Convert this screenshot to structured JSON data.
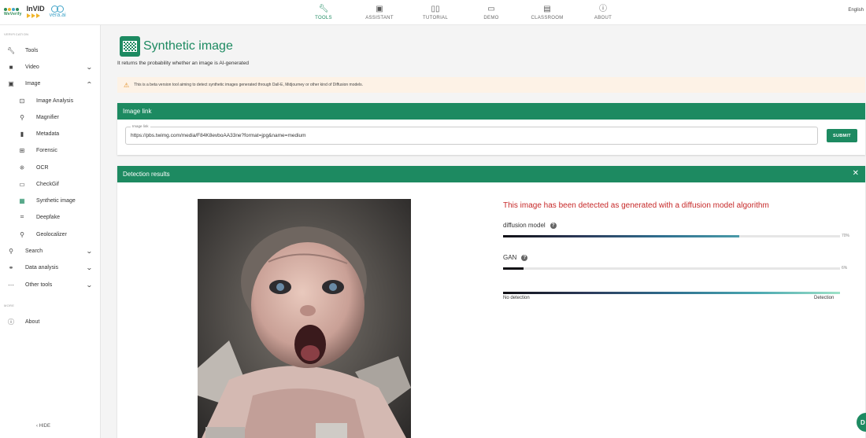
{
  "brand": {
    "weverify": "WeVerify",
    "invid": "InVID",
    "vera": "vera.ai"
  },
  "nav": {
    "tabs": [
      {
        "label": "TOOLS",
        "icon": "wrench-icon"
      },
      {
        "label": "ASSISTANT",
        "icon": "robot-icon"
      },
      {
        "label": "TUTORIAL",
        "icon": "book-icon"
      },
      {
        "label": "DEMO",
        "icon": "projector-icon"
      },
      {
        "label": "CLASSROOM",
        "icon": "classroom-icon"
      },
      {
        "label": "ABOUT",
        "icon": "info-icon"
      }
    ],
    "active": "TOOLS",
    "language": "English"
  },
  "sidebar": {
    "section_verification": "VERIFICATION",
    "section_more": "MORE",
    "items": [
      {
        "label": "Tools",
        "icon": "wrench-icon"
      },
      {
        "label": "Video",
        "icon": "video-icon"
      },
      {
        "label": "Image",
        "icon": "image-icon"
      },
      {
        "label": "Image Analysis",
        "icon": "image-analysis-icon"
      },
      {
        "label": "Magnifier",
        "icon": "magnifier-icon"
      },
      {
        "label": "Metadata",
        "icon": "metadata-icon"
      },
      {
        "label": "Forensic",
        "icon": "forensic-icon"
      },
      {
        "label": "OCR",
        "icon": "ocr-icon"
      },
      {
        "label": "CheckGif",
        "icon": "checkgif-icon"
      },
      {
        "label": "Synthetic image",
        "icon": "synthetic-image-icon"
      },
      {
        "label": "Deepfake",
        "icon": "deepfake-icon"
      },
      {
        "label": "Geolocalizer",
        "icon": "geolocalizer-icon"
      },
      {
        "label": "Search",
        "icon": "search-icon"
      },
      {
        "label": "Data analysis",
        "icon": "data-analysis-icon"
      },
      {
        "label": "Other tools",
        "icon": "more-icon"
      },
      {
        "label": "About",
        "icon": "info-icon"
      }
    ],
    "active_item": "Synthetic image",
    "hide_label": "HIDE"
  },
  "main": {
    "title": "Synthetic image",
    "subtitle": "It returns the probability whether an image is AI-generated",
    "warning": "This is a beta version tool aiming to detect synthetic images generated through Dall-E, Midjourney or other kind of Diffusion models.",
    "image_link_card": {
      "header": "Image link",
      "field_label": "Image link",
      "field_value": "https://pbs.twimg.com/media/F84K8evboAA33ne?format=jpg&name=medium",
      "submit_label": "SUBMIT"
    },
    "detection_card": {
      "header": "Detection results",
      "result_text": "This image has been detected as generated with a diffusion model algorithm",
      "metrics": [
        {
          "name": "diffusion model",
          "value": 70,
          "label": "70%"
        },
        {
          "name": "GAN",
          "value": 6,
          "label": "6%"
        }
      ],
      "legend_left": "No detection",
      "legend_right": "Detection"
    }
  },
  "colors": {
    "accent": "#1d8a61",
    "alert_text": "#c62828",
    "warning_bg": "#fdf2e6"
  }
}
